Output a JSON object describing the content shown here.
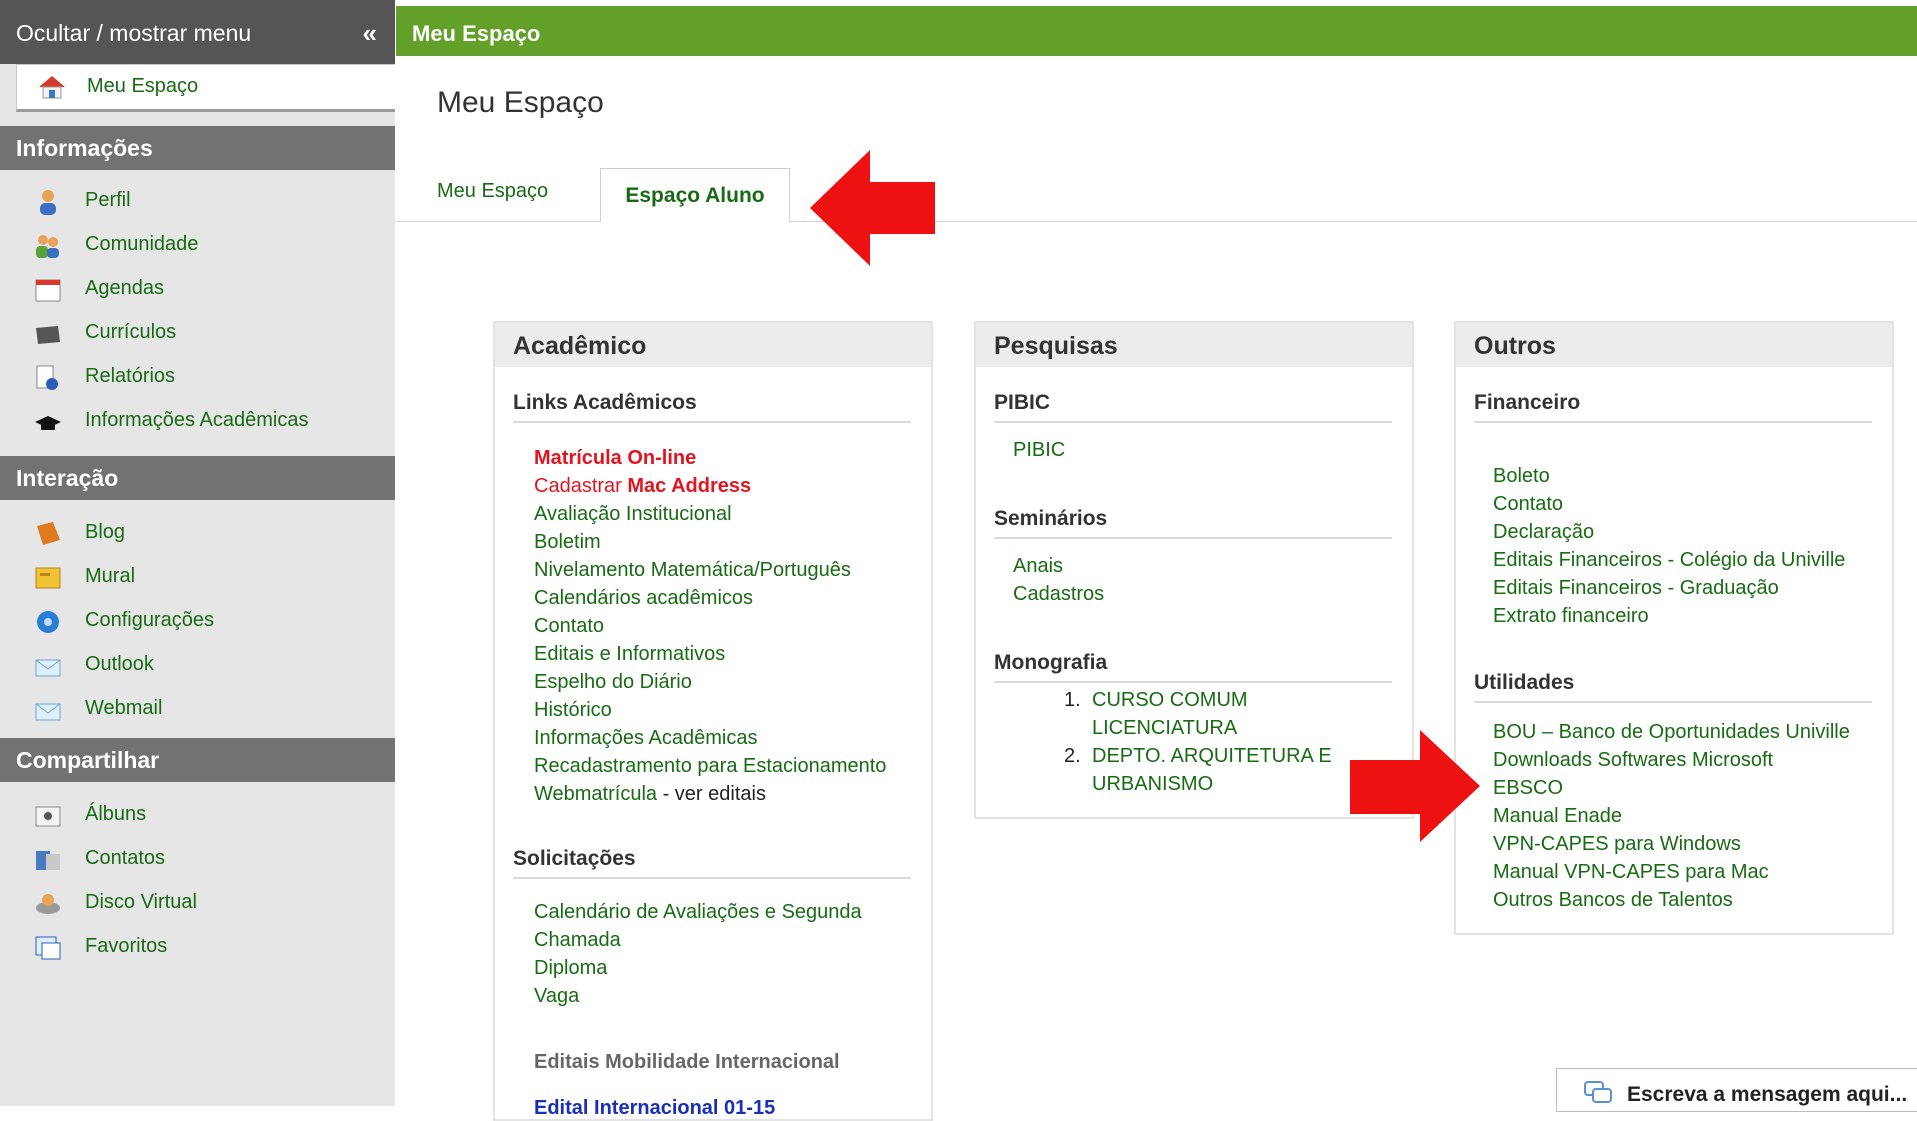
{
  "sidebar": {
    "toggle_label": "Ocultar / mostrar menu",
    "toggle_icon": "«",
    "home_label": "Meu Espaço",
    "sections": [
      {
        "title": "Informações",
        "items": [
          "Perfil",
          "Comunidade",
          "Agendas",
          "Currículos",
          "Relatórios",
          "Informações Acadêmicas"
        ]
      },
      {
        "title": "Interação",
        "items": [
          "Blog",
          "Mural",
          "Configurações",
          "Outlook",
          "Webmail"
        ]
      },
      {
        "title": "Compartilhar",
        "items": [
          "Álbuns",
          "Contatos",
          "Disco Virtual",
          "Favoritos"
        ]
      }
    ]
  },
  "header": {
    "bar_title": "Meu Espaço",
    "page_title": "Meu Espaço"
  },
  "tabs": [
    {
      "label": "Meu Espaço",
      "active": false
    },
    {
      "label": "Espaço Aluno",
      "active": true
    }
  ],
  "panels": {
    "academico": {
      "title": "Acadêmico",
      "links_title": "Links Acadêmicos",
      "matricula": "Matrícula On-line",
      "cadastrar_prefix": "Cadastrar ",
      "cadastrar_bold": "Mac Address",
      "links": [
        "Avaliação Institucional",
        "Boletim",
        "Nivelamento Matemática/Português",
        "Calendários acadêmicos",
        "Contato",
        "Editais e Informativos",
        "Espelho do Diário",
        "Histórico",
        "Informações Acadêmicas",
        "Recadastramento para Estacionamento"
      ],
      "webmatricula": "Webmatrícula",
      "webmatricula_suffix": " - ver editais",
      "solicitacoes_title": "Solicitações",
      "solicitacoes": [
        "Calendário de Avaliações e Segunda",
        "Chamada",
        "Diploma",
        "Vaga"
      ],
      "mobilidade_title": "Editais Mobilidade Internacional",
      "edital": "Edital Internacional 01-15"
    },
    "pesquisas": {
      "title": "Pesquisas",
      "pibic_title": "PIBIC",
      "pibic_link": "PIBIC",
      "seminarios_title": "Seminários",
      "seminarios": [
        "Anais",
        "Cadastros"
      ],
      "monografia_title": "Monografia",
      "monografia": [
        {
          "num": "1.",
          "lines": [
            "CURSO COMUM",
            "LICENCIATURA"
          ]
        },
        {
          "num": "2.",
          "lines": [
            "DEPTO. ARQUITETURA E",
            "URBANISMO"
          ]
        }
      ]
    },
    "outros": {
      "title": "Outros",
      "financeiro_title": "Financeiro",
      "financeiro": [
        "Boleto",
        "Contato",
        "Declaração",
        "Editais Financeiros - Colégio da Univille",
        "Editais Financeiros - Graduação",
        "Extrato financeiro"
      ],
      "utilidades_title": "Utilidades",
      "utilidades": [
        "BOU – Banco de Oportunidades Univille",
        "Downloads Softwares Microsoft",
        "EBSCO",
        "Manual Enade",
        "VPN-CAPES para Windows",
        "Manual VPN-CAPES para Mac",
        "Outros Bancos de Talentos"
      ]
    }
  },
  "chat": {
    "placeholder": "Escreva a mensagem aqui..."
  },
  "colors": {
    "green_bar": "#62a02a",
    "link_green": "#186b14",
    "red": "#e4141e",
    "sidebar_header": "#727272"
  }
}
